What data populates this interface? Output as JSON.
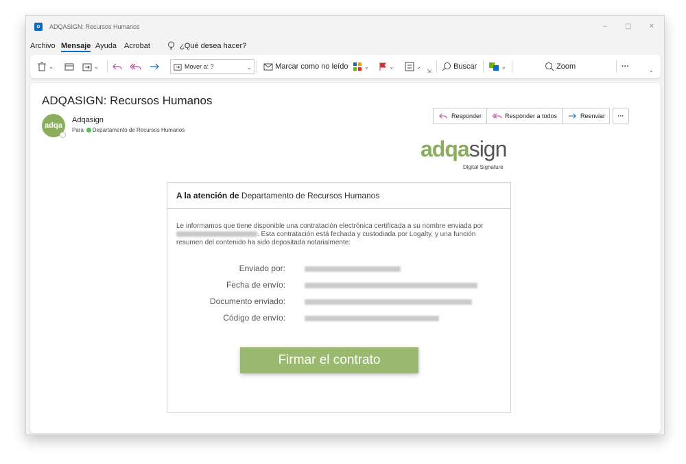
{
  "window": {
    "title": "ADQASIGN: Recursos Humanos",
    "minimize": "–",
    "restore": "▢",
    "close": "✕"
  },
  "menu": {
    "items": [
      "Archivo",
      "Mensaje",
      "Ayuda",
      "Acrobat"
    ],
    "active": "Mensaje",
    "tell_me": "¿Qué desea hacer?"
  },
  "ribbon": {
    "move_to": "Mover a: ?",
    "mark_unread": "Marcar como no leído",
    "search": "Buscar",
    "zoom": "Zoom",
    "more": "···"
  },
  "email": {
    "subject": "ADQASIGN: Recursos Humanos",
    "avatar_text": "adqa",
    "sender": "Adqasign",
    "to_label": "Para",
    "to_value": "Departamento de Recursos Humanos",
    "actions": {
      "reply": "Responder",
      "reply_all": "Responder a todos",
      "forward": "Reenviar",
      "more": "···"
    }
  },
  "logo": {
    "part1": "adqa",
    "part2": "sign",
    "tagline": "Digital Signature"
  },
  "card": {
    "heading_bold": "A la atención de",
    "heading_rest": "Departamento de Recursos Humanos",
    "intro_1": "Le informamos que tiene disponible una contratación electrónica certificada a su nombre enviada por",
    "intro_2": ". Esta contratación está fechada y custodiada por Logalty, y una función",
    "intro_3": "resumen del contenido ha sido depositada notarialmente:",
    "fields": [
      {
        "label": "Enviado por:"
      },
      {
        "label": "Fecha de envío:"
      },
      {
        "label": "Documento enviado:"
      },
      {
        "label": "Código de envío:"
      }
    ],
    "button": "Firmar el contrato"
  },
  "colors": {
    "brand_green": "#8aae5d",
    "button_green": "#9ab96f",
    "outlook_blue": "#0f6cbd"
  }
}
